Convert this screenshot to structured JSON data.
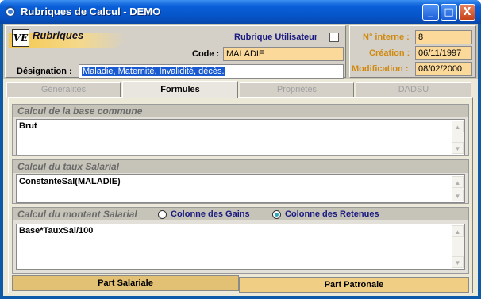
{
  "window": {
    "title": "Rubriques de Calcul - DEMO",
    "controls": {
      "minimize": "_",
      "maximize": "□",
      "close": "X"
    }
  },
  "logo": {
    "mark": "VE",
    "text": "Rubriques"
  },
  "header": {
    "rubrique_utilisateur_label": "Rubrique Utilisateur",
    "rubrique_utilisateur_checked": false,
    "code_label": "Code :",
    "code_value": "MALADIE",
    "designation_label": "Désignation :",
    "designation_value": "Maladie, Maternité, Invalidité, décès.",
    "interne_label": "N° interne :",
    "interne_value": "8",
    "creation_label": "Création :",
    "creation_value": "06/11/1997",
    "modification_label": "Modification :",
    "modification_value": "08/02/2000"
  },
  "tabs": [
    {
      "label": "Généralités",
      "active": false
    },
    {
      "label": "Formules",
      "active": true
    },
    {
      "label": "Propriétés",
      "active": false
    },
    {
      "label": "DADSU",
      "active": false
    }
  ],
  "sections": {
    "base": {
      "title": "Calcul de la base commune",
      "value": "Brut"
    },
    "taux": {
      "title": "Calcul du taux Salarial",
      "value": "ConstanteSal(MALADIE)"
    },
    "montant": {
      "title": "Calcul du montant Salarial",
      "value": "Base*TauxSal/100",
      "radio_gains": "Colonne des Gains",
      "radio_retenues": "Colonne des Retenues",
      "selected": "retenues"
    }
  },
  "bottom_tabs": [
    {
      "label": "Part Salariale",
      "active": true
    },
    {
      "label": "Part Patronale",
      "active": false
    }
  ],
  "colors": {
    "titlebar": "#0654c8",
    "field_bg": "#fbd99a",
    "orange_label": "#d08a10"
  }
}
